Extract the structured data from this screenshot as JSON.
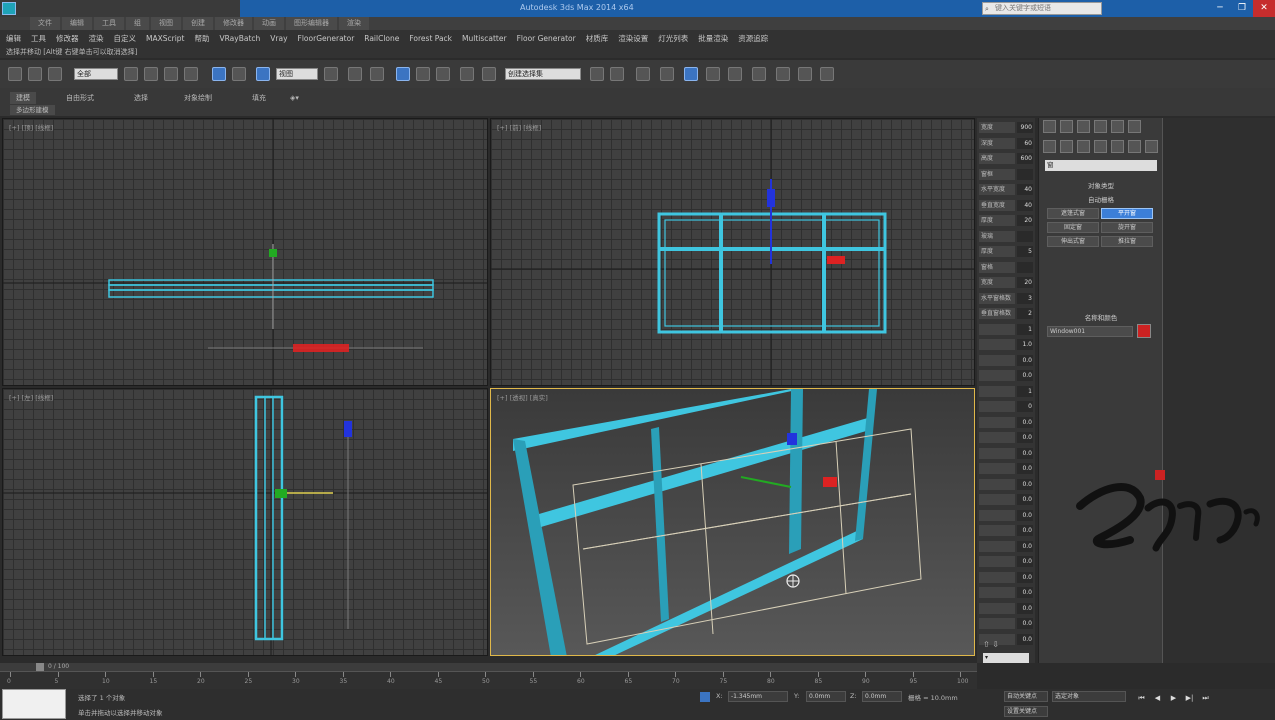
{
  "window": {
    "app_icon": "3ds-max-icon",
    "title": "Autodesk 3ds Max 2014 x64",
    "search_placeholder": "键入关键字或短语",
    "buttons": [
      "─",
      "❐",
      "✕"
    ]
  },
  "tabs": [
    "文件",
    "编辑",
    "工具",
    "组",
    "视图",
    "创建",
    "修改器",
    "动画",
    "图形编辑器",
    "渲染"
  ],
  "menu": {
    "items": [
      "编辑",
      "工具",
      "修改器",
      "渲染",
      "自定义",
      "MAXScript",
      "帮助",
      "VRayBatch",
      "Vray",
      "FloorGenerator",
      "RailClone",
      "Forest Pack",
      "Multiscatter",
      "Floor Generator",
      "材质库",
      "渲染设置",
      "灯光列表",
      "批量渲染",
      "资源追踪"
    ],
    "subline": "选择并移动 [Alt键 右键单击可以取消选择]"
  },
  "toolbar": {
    "selection_filter": "全部",
    "ref_coord": "视图",
    "named_selection": "创建选择集"
  },
  "ribbon": {
    "tabs": [
      "建模",
      "自由形式",
      "选择",
      "对象绘制",
      "填充"
    ],
    "subtab": "多边形建模"
  },
  "viewports": [
    {
      "id": "top",
      "label": "[+] [顶] [线框]"
    },
    {
      "id": "front",
      "label": "[+] [前] [线框]"
    },
    {
      "id": "left",
      "label": "[+] [左] [线框]"
    },
    {
      "id": "perspective",
      "label": "[+] [透视] [真实]"
    }
  ],
  "side_params": [
    {
      "label": "宽度",
      "value": "900"
    },
    {
      "label": "深度",
      "value": "60"
    },
    {
      "label": "高度",
      "value": "600"
    },
    {
      "label": "窗框",
      "value": ""
    },
    {
      "label": "水平宽度",
      "value": "40"
    },
    {
      "label": "垂直宽度",
      "value": "40"
    },
    {
      "label": "厚度",
      "value": "20"
    },
    {
      "label": "玻璃",
      "value": ""
    },
    {
      "label": "厚度",
      "value": "5"
    },
    {
      "label": "窗格",
      "value": ""
    },
    {
      "label": "宽度",
      "value": "20"
    },
    {
      "label": "水平窗格数",
      "value": "3"
    },
    {
      "label": "垂直窗格数",
      "value": "2"
    },
    {
      "label": "",
      "value": "1"
    },
    {
      "label": "",
      "value": "1.0"
    },
    {
      "label": "",
      "value": "0.0"
    },
    {
      "label": "",
      "value": "0.0"
    },
    {
      "label": "",
      "value": "1"
    },
    {
      "label": "",
      "value": "0"
    },
    {
      "label": "",
      "value": "0.0"
    },
    {
      "label": "",
      "value": "0.0"
    },
    {
      "label": "",
      "value": "0.0"
    },
    {
      "label": "",
      "value": "0.0"
    },
    {
      "label": "",
      "value": "0.0"
    },
    {
      "label": "",
      "value": "0.0"
    },
    {
      "label": "",
      "value": "0.0"
    },
    {
      "label": "",
      "value": "0.0"
    },
    {
      "label": "",
      "value": "0.0"
    },
    {
      "label": "",
      "value": "0.0"
    },
    {
      "label": "",
      "value": "0.0"
    },
    {
      "label": "",
      "value": "0.0"
    },
    {
      "label": "",
      "value": "0.0"
    },
    {
      "label": "",
      "value": "0.0"
    },
    {
      "label": "",
      "value": "0.0"
    }
  ],
  "command_panel": {
    "category_dropdown": "窗",
    "rollout_title": "对象类型",
    "autogrid": "自动栅格",
    "buttons": [
      {
        "label": "遮篷式窗",
        "selected": false
      },
      {
        "label": "平开窗",
        "selected": true
      },
      {
        "label": "固定窗",
        "selected": false
      },
      {
        "label": "旋开窗",
        "selected": false
      },
      {
        "label": "伸出式窗",
        "selected": false
      },
      {
        "label": "推拉窗",
        "selected": false
      }
    ],
    "name_rollout": "名称和颜色",
    "name_value": "Window001",
    "object_color": "#cc2222"
  },
  "timeline": {
    "frame_readout": "0 / 100",
    "ticks": [
      "0",
      "5",
      "10",
      "15",
      "20",
      "25",
      "30",
      "35",
      "40",
      "45",
      "50",
      "55",
      "60",
      "65",
      "70",
      "75",
      "80",
      "85",
      "90",
      "95",
      "100"
    ]
  },
  "status": {
    "selected": "选择了 1 个对象",
    "prompt": "单击并拖动以选择并移动对象",
    "x_label": "X:",
    "x_value": "-1.345mm",
    "y_label": "Y:",
    "y_value": "0.0mm",
    "z_label": "Z:",
    "z_value": "0.0mm",
    "grid": "栅格 = 10.0mm",
    "auto_key": "自动关键点",
    "set_key": "设置关键点",
    "key_filter": "选定对象",
    "playback": [
      "⏮",
      "◀",
      "▶",
      "▶|",
      "⏭"
    ]
  },
  "colors": {
    "window_frame": "#3fc6e0",
    "axis_x": "#dd2222",
    "axis_y": "#22aa22",
    "axis_z": "#2233dd",
    "active_border": "#e0b84a"
  }
}
